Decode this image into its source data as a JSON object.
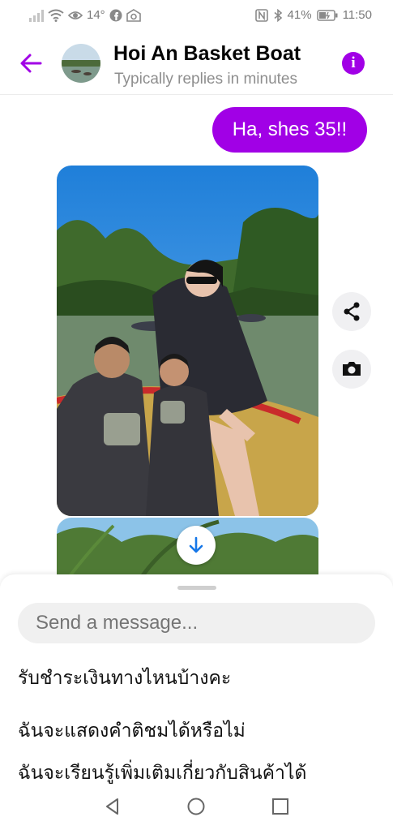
{
  "status_bar": {
    "left_text": "14°",
    "battery_text": "41%",
    "time": "11:50"
  },
  "header": {
    "title": "Hoi An Basket Boat",
    "subtitle": "Typically replies in minutes",
    "accent_color": "#a100e6"
  },
  "chat": {
    "outgoing_message": "Ha, shes 35!!"
  },
  "composer": {
    "placeholder": "Send a message..."
  },
  "suggested_questions": [
    "รับชำระเงินทางไหนบ้างคะ",
    "ฉันจะแสดงคำติชมได้หรือไม่",
    "ฉันจะเรียนรู้เพิ่มเติมเกี่ยวกับสินค้าได้"
  ],
  "icons": {
    "back": "back-arrow-icon",
    "info": "info-icon",
    "share": "share-icon",
    "camera": "camera-icon",
    "scroll_down": "arrow-down-icon"
  }
}
